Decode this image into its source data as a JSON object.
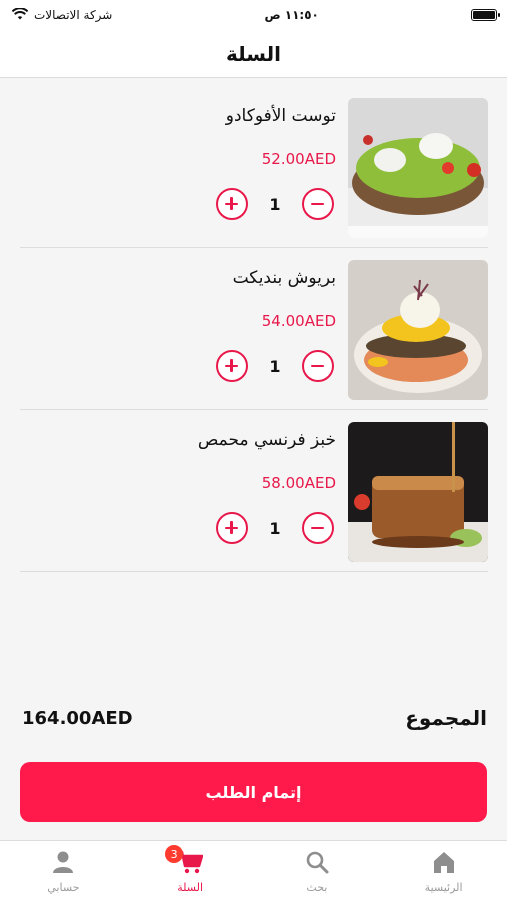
{
  "status_bar": {
    "carrier": "شركة الاتصالات",
    "time": "١١:٥٠ ص"
  },
  "header": {
    "title": "السلة"
  },
  "currency": "AED",
  "items": [
    {
      "name": "توست الأفوكادو",
      "price": "52.00AED",
      "quantity": "1"
    },
    {
      "name": "بريوش بنديكت",
      "price": "54.00AED",
      "quantity": "1"
    },
    {
      "name": "خبز فرنسي محمص",
      "price": "58.00AED",
      "quantity": "1"
    }
  ],
  "total": {
    "label": "المجموع",
    "amount": "164.00AED"
  },
  "checkout": {
    "label": "إتمام الطلب"
  },
  "tabs": [
    {
      "label": "الرئيسية",
      "icon": "home-icon"
    },
    {
      "label": "بحث",
      "icon": "search-icon"
    },
    {
      "label": "السلة",
      "icon": "cart-icon",
      "badge": "3",
      "active": true
    },
    {
      "label": "حسابي",
      "icon": "user-icon"
    }
  ],
  "colors": {
    "accent": "#ff1a4b",
    "price": "#e8184a",
    "badge": "#ff3b30"
  }
}
